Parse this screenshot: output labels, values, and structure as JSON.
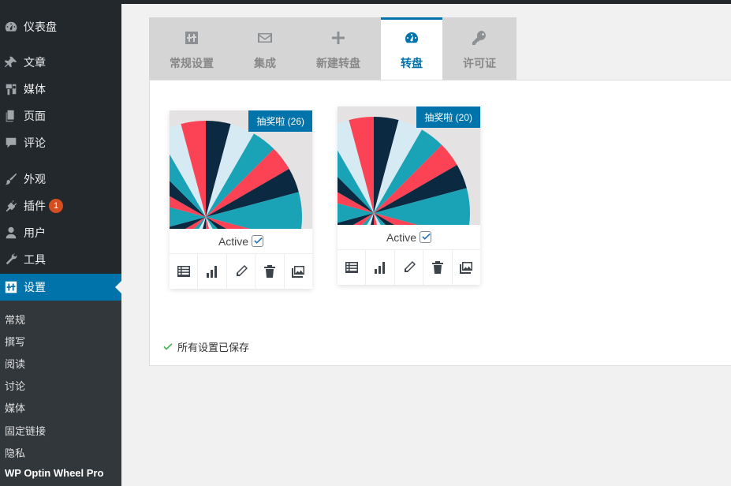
{
  "sidebar": {
    "items": [
      {
        "label": "仪表盘",
        "icon": "dashboard-icon"
      },
      {
        "label": "文章",
        "icon": "pin-icon"
      },
      {
        "label": "媒体",
        "icon": "media-icon"
      },
      {
        "label": "页面",
        "icon": "page-icon"
      },
      {
        "label": "评论",
        "icon": "comment-icon"
      },
      {
        "label": "外观",
        "icon": "brush-icon"
      },
      {
        "label": "插件",
        "icon": "plugin-icon",
        "badge": "1"
      },
      {
        "label": "用户",
        "icon": "user-icon"
      },
      {
        "label": "工具",
        "icon": "wrench-icon"
      },
      {
        "label": "设置",
        "icon": "settings-icon",
        "current": true
      }
    ],
    "submenu": [
      "常规",
      "撰写",
      "阅读",
      "讨论",
      "媒体",
      "固定链接",
      "隐私",
      "WP Optin Wheel Pro"
    ]
  },
  "tabs": [
    {
      "label": "常规设置",
      "icon": "sliders-icon"
    },
    {
      "label": "集成",
      "icon": "envelope-icon"
    },
    {
      "label": "新建转盘",
      "icon": "plus-icon"
    },
    {
      "label": "转盘",
      "icon": "gauge-icon",
      "active": true
    },
    {
      "label": "许可证",
      "icon": "key-icon"
    }
  ],
  "wheels": [
    {
      "tag": "抽奖啦 (26)",
      "status": "Active",
      "checked": true
    },
    {
      "tag": "抽奖啦 (20)",
      "status": "Active",
      "checked": true
    }
  ],
  "saved_message": "所有设置已保存",
  "colors": {
    "accent": "#0073aa",
    "sidebar_bg": "#23282d",
    "wheel_red": "#fc4355",
    "wheel_navy": "#0b2a41",
    "wheel_teal": "#1aa3b6",
    "wheel_light": "#d6eaf3",
    "success": "#46b450"
  }
}
